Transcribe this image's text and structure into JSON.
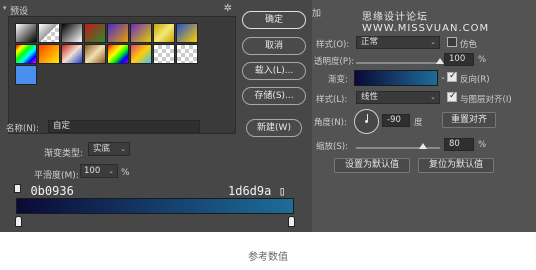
{
  "presets": {
    "label": "预设",
    "gear_icon": "gear-icon"
  },
  "swatches": [
    {
      "css": "linear-gradient(135deg,#ffffff,#000000)"
    },
    {
      "css": "linear-gradient(135deg,#ffffff,#9a9a9a 50%,transparent 50%),repeating-conic-gradient(#cccccc 0 25%,#ffffff 0 50%) 0 0/8px 8px"
    },
    {
      "css": "linear-gradient(135deg,#000000,#ffffff)"
    },
    {
      "css": "linear-gradient(135deg,#c41a1a,#2d8a2d)"
    },
    {
      "css": "linear-gradient(135deg,#4a2ad0,#e8a000)"
    },
    {
      "css": "linear-gradient(135deg,#6e2ac0,#e0d000)"
    },
    {
      "css": "linear-gradient(135deg,#c8a400,#f4e878,#c8a400)"
    },
    {
      "css": "linear-gradient(135deg,#2050d0,#ffd000)"
    },
    {
      "css": "linear-gradient(135deg,#ff0000,#ffff00,#00ff00,#00ffff,#0000ff,#ff00ff)"
    },
    {
      "css": "linear-gradient(135deg,#ff4000,#ffee00)"
    },
    {
      "css": "linear-gradient(135deg,#d02020,#f0e0d0 50%,#2040d0)"
    },
    {
      "css": "linear-gradient(135deg,#8a5a20,#f0e0b0,#8a5a20)"
    },
    {
      "css": "linear-gradient(135deg,#ff0000,#ffa500,#ffff00,#00ff00,#0000ff,#8a00ff)"
    },
    {
      "css": "linear-gradient(135deg,#e04080,#ffd000,#40c0ff)"
    },
    {
      "css": "repeating-conic-gradient(#cccccc 0 25%,#ffffff 0 50%) 0 0/8px 8px"
    },
    {
      "css": "repeating-conic-gradient(#cccccc 0 25%,#ffffff 0 50%) 0 0/8px 8px"
    },
    {
      "css": "linear-gradient(135deg,#4a8ef0,#4a8ef0)"
    }
  ],
  "buttons": {
    "ok": "确定",
    "cancel": "取消",
    "load": "载入(L)...",
    "save": "存储(S)...",
    "new": "新建(W)"
  },
  "name": {
    "label": "名称(N):",
    "value": "自定"
  },
  "gradient_type": {
    "label": "渐变类型:",
    "value": "实底"
  },
  "smoothness": {
    "label": "平滑度(M):",
    "value": "100",
    "unit": "%"
  },
  "gradient": {
    "color_left": "0b0936",
    "color_right": "1d6d9a",
    "css": "linear-gradient(to right, #0b0936, #1d6d9a)"
  },
  "overlay": {
    "title_fragment": "加",
    "watermark": "思缘设计论坛 WWW.MISSVUAN.COM",
    "blend_mode": {
      "label": "样式(O):",
      "value": "正常"
    },
    "dither": {
      "label": "仿色",
      "checked": false
    },
    "opacity": {
      "label": "透明度(P):",
      "value": "100",
      "unit": "%",
      "level": 1.0
    },
    "gradient": {
      "label": "渐变:"
    },
    "reverse": {
      "label": "反向(R)",
      "checked": true
    },
    "style": {
      "label": "样式(L):",
      "value": "线性"
    },
    "align": {
      "label": "与图层对齐(I)",
      "checked": true
    },
    "angle": {
      "label": "角度(N):",
      "value": "-90",
      "unit": "度"
    },
    "reset_align": "重置对齐",
    "scale": {
      "label": "缩放(S):",
      "value": "80",
      "unit": "%",
      "level": 0.8
    },
    "make_default": "设置为默认值",
    "reset_default": "复位为默认值"
  },
  "caption": "参考数值"
}
